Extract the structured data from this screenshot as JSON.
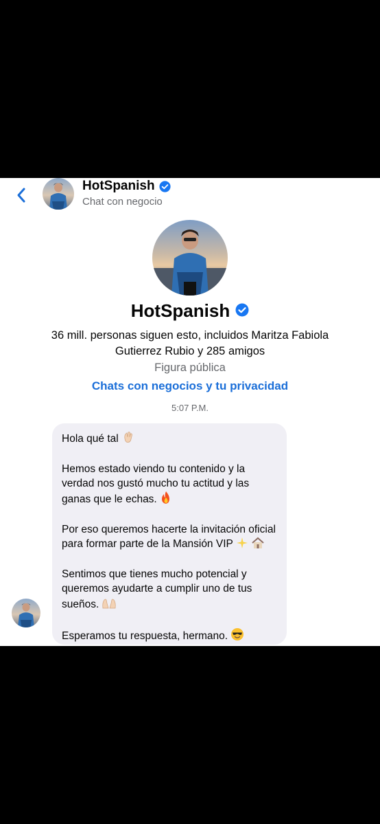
{
  "header": {
    "name": "HotSpanish",
    "subtitle": "Chat con negocio"
  },
  "profile": {
    "name": "HotSpanish",
    "followers_text": "36 mill. personas siguen esto, incluidos Maritza Fabiola Gutierrez Rubio y 285 amigos",
    "category": "Figura pública",
    "privacy_link": "Chats con negocios y tu privacidad"
  },
  "timestamp": "5:07 P.M.",
  "message": {
    "paragraphs": [
      {
        "text": "Hola qué tal",
        "emoji": "waving-hand"
      },
      {
        "text": "Hemos estado viendo tu contenido y la verdad nos gustó mucho tu actitud y las ganas que le echas.",
        "emoji": "fire"
      },
      {
        "text": "Por eso queremos hacerte la invitación oficial para formar parte de la Mansión VIP",
        "emoji": "sparkles-house"
      },
      {
        "text": "Sentimos que tienes mucho potencial y queremos ayudarte a cumplir uno de tus sueños.",
        "emoji": "raising-hands"
      },
      {
        "text": "Esperamos tu respuesta, hermano.",
        "emoji": "sunglasses-face"
      }
    ]
  },
  "colors": {
    "accent": "#1a6ed8",
    "bubble": "#f0eff5",
    "verified": "#1877f2"
  }
}
